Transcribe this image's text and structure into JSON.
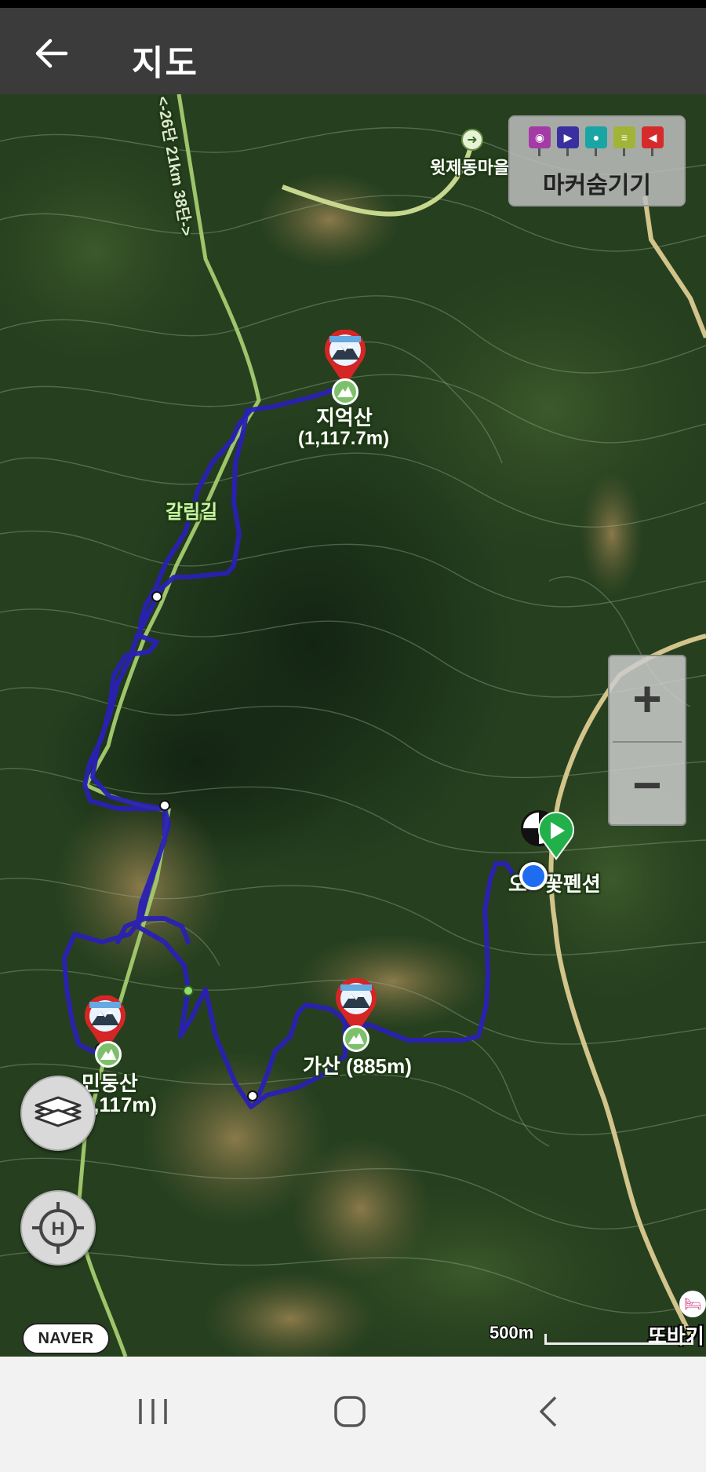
{
  "app": {
    "title": "지도"
  },
  "marker_toggle": {
    "label": "마커숨기기",
    "markers": [
      {
        "icon": "camera-icon",
        "color": "#a43aa6"
      },
      {
        "icon": "video-icon",
        "color": "#3a2fa0"
      },
      {
        "icon": "microphone-icon",
        "color": "#1aa5a5"
      },
      {
        "icon": "memo-icon",
        "color": "#a2b437"
      },
      {
        "icon": "flag-icon",
        "color": "#d62b2b"
      }
    ]
  },
  "map": {
    "places": {
      "village": "윗제동마을",
      "trail_distance": "<-26단 21km 38단->",
      "junction": "갈림길",
      "pension": "꽃펜션",
      "pension_prefix": "오",
      "motel": "또바기"
    },
    "peaks": {
      "jieok": {
        "name": "지억산",
        "height": "(1,117.7m)"
      },
      "gasan": {
        "name": "가산 (885m)"
      },
      "mindung": {
        "name": "민둥산",
        "height": "(1,117m)"
      }
    },
    "watermark": "NAVER",
    "route_color": "#2a20b5"
  },
  "zoom": {
    "in": "+",
    "out": "−"
  },
  "scale": {
    "label": "500m"
  },
  "logo": "NAVER"
}
